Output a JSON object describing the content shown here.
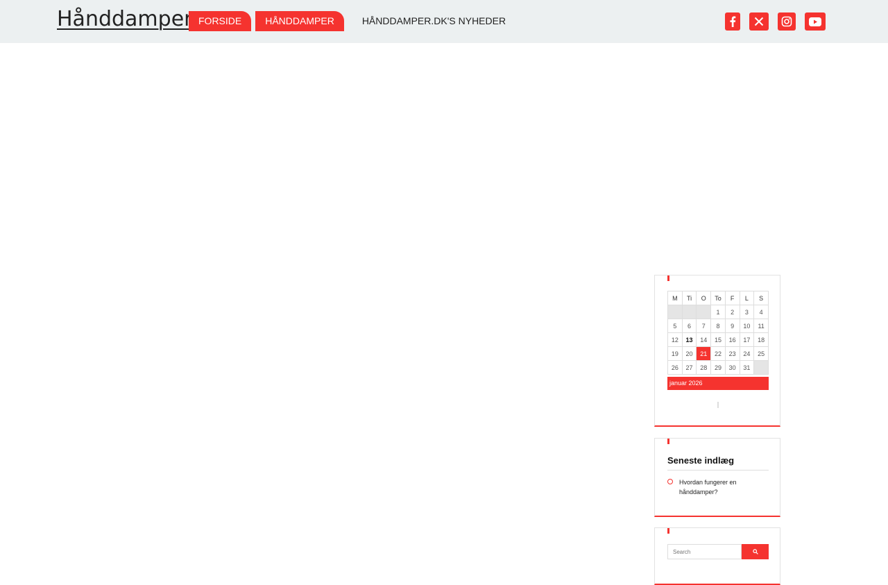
{
  "header": {
    "site_title": "Hånddamper",
    "nav": [
      {
        "label": "FORSIDE"
      },
      {
        "label": "HÅNDDAMPER"
      },
      {
        "label": "HÅNDDAMPER.DK'S NYHEDER"
      }
    ],
    "social": [
      "facebook-icon",
      "x-icon",
      "instagram-icon",
      "youtube-icon"
    ]
  },
  "calendar": {
    "weekdays": [
      "M",
      "Ti",
      "O",
      "To",
      "F",
      "L",
      "S"
    ],
    "rows": [
      [
        "",
        "",
        "",
        "1",
        "2",
        "3",
        "4"
      ],
      [
        "5",
        "6",
        "7",
        "8",
        "9",
        "10",
        "11"
      ],
      [
        "12",
        "13",
        "14",
        "15",
        "16",
        "17",
        "18"
      ],
      [
        "19",
        "20",
        "21",
        "22",
        "23",
        "24",
        "25"
      ],
      [
        "26",
        "27",
        "28",
        "29",
        "30",
        "31",
        ""
      ]
    ],
    "today": "21",
    "linked": [
      "13"
    ],
    "month_label": "januar 2026"
  },
  "recent_posts": {
    "title": "Seneste indlæg",
    "items": [
      {
        "label": "Hvordan fungerer en hånddamper?"
      }
    ]
  },
  "search": {
    "placeholder": "Search",
    "button_icon": "search-icon"
  },
  "colors": {
    "accent": "#f5332f",
    "header_bg": "#ecf0f1"
  }
}
